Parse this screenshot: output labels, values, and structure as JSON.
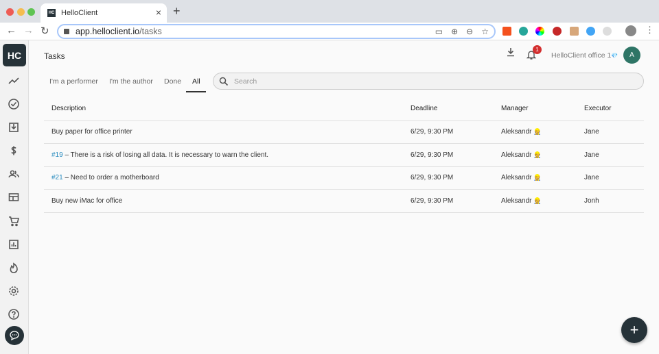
{
  "browser": {
    "tab_title": "HelloClient",
    "tab_favicon": "HC",
    "url_host": "app.helloclient.io",
    "url_path": "/tasks",
    "new_tab": "+",
    "close": "×"
  },
  "app": {
    "logo": "HC",
    "page_title": "Tasks",
    "notification_count": "1",
    "org_name": "HelloClient office 1",
    "org_badge": "💎",
    "avatar_letter": "A",
    "fab": "+"
  },
  "filters": {
    "tabs": [
      "I'm a performer",
      "I'm the author",
      "Done",
      "All"
    ],
    "active": "All",
    "search_placeholder": "Search"
  },
  "table": {
    "headers": [
      "Description",
      "Deadline",
      "Manager",
      "Executor"
    ],
    "rows": [
      {
        "id": "",
        "description": "Buy paper for office printer",
        "deadline": "6/29, 9:30 PM",
        "manager": "Aleksandr",
        "manager_emoji": "👷",
        "executor": "Jane"
      },
      {
        "id": "#19",
        "description": " – There is a risk of losing all data. It is necessary to warn the client.",
        "deadline": "6/29, 9:30 PM",
        "manager": "Aleksandr",
        "manager_emoji": "👷",
        "executor": "Jane"
      },
      {
        "id": "#21",
        "description": " – Need to order a motherboard",
        "deadline": "6/29, 9:30 PM",
        "manager": "Aleksandr",
        "manager_emoji": "👷",
        "executor": "Jane"
      },
      {
        "id": "",
        "description": "Buy new iMac for office",
        "deadline": "6/29, 9:30 PM",
        "manager": "Aleksandr",
        "manager_emoji": "👷",
        "executor": "Jonh"
      }
    ]
  },
  "colors": {
    "brand": "#263238",
    "link": "#2a8cbf",
    "badge": "#d32f2f",
    "avatar": "#2e7566"
  }
}
